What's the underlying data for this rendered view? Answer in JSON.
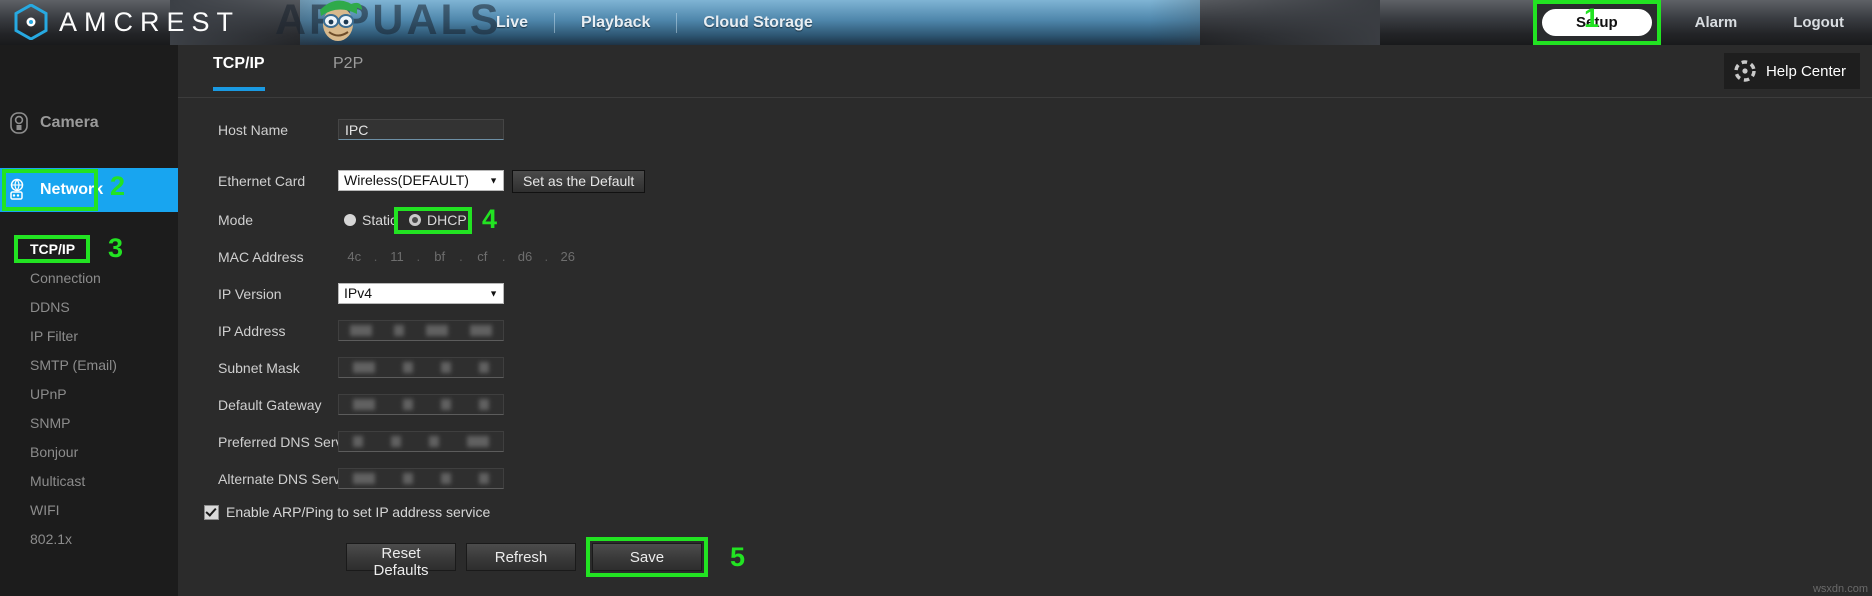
{
  "brand": {
    "name": "AMCREST",
    "logo_icon": "amcrest-hexagon-logo",
    "watermark": "APPUALS"
  },
  "topnav": {
    "main_items": [
      {
        "label": "Live",
        "name": "live"
      },
      {
        "label": "Playback",
        "name": "playback"
      },
      {
        "label": "Cloud Storage",
        "name": "cloud-storage"
      }
    ],
    "right_items": [
      {
        "label": "Setup",
        "name": "setup",
        "highlighted": true
      },
      {
        "label": "Alarm",
        "name": "alarm"
      },
      {
        "label": "Logout",
        "name": "logout"
      }
    ]
  },
  "annotations": {
    "step1": "1",
    "step2": "2",
    "step3": "3",
    "step4": "4",
    "step5": "5",
    "highlight_color": "#22e322"
  },
  "sidebar": {
    "categories": [
      {
        "label": "Camera",
        "icon": "camera-icon",
        "active": false
      },
      {
        "label": "Network",
        "icon": "network-icon",
        "active": true
      }
    ],
    "items": [
      {
        "label": "TCP/IP",
        "selected": true
      },
      {
        "label": "Connection",
        "selected": false
      },
      {
        "label": "DDNS",
        "selected": false
      },
      {
        "label": "IP Filter",
        "selected": false
      },
      {
        "label": "SMTP (Email)",
        "selected": false
      },
      {
        "label": "UPnP",
        "selected": false
      },
      {
        "label": "SNMP",
        "selected": false
      },
      {
        "label": "Bonjour",
        "selected": false
      },
      {
        "label": "Multicast",
        "selected": false
      },
      {
        "label": "WIFI",
        "selected": false
      },
      {
        "label": "802.1x",
        "selected": false
      }
    ]
  },
  "content": {
    "tabs": [
      {
        "label": "TCP/IP",
        "active": true
      },
      {
        "label": "P2P",
        "active": false
      }
    ],
    "help_center": {
      "label": "Help Center",
      "icon": "lifebuoy-icon"
    }
  },
  "form": {
    "host_name": {
      "label": "Host Name",
      "value": "IPC",
      "placeholder": ""
    },
    "ethernet_card": {
      "label": "Ethernet Card",
      "value": "Wireless(DEFAULT)",
      "caret_icon": "chevron-down-icon",
      "set_default_button": "Set as the Default"
    },
    "mode": {
      "label": "Mode",
      "options": [
        {
          "label": "Static",
          "selected": false
        },
        {
          "label": "DHCP",
          "selected": true
        }
      ]
    },
    "mac_address": {
      "label": "MAC Address",
      "octets": [
        "4c",
        "11",
        "bf",
        "cf",
        "d6",
        "26"
      ],
      "separator": "."
    },
    "ip_version": {
      "label": "IP Version",
      "value": "IPv4",
      "caret_icon": "chevron-down-icon"
    },
    "ip_address": {
      "label": "IP Address",
      "value": ""
    },
    "subnet_mask": {
      "label": "Subnet Mask",
      "value": ""
    },
    "default_gateway": {
      "label": "Default Gateway",
      "value": ""
    },
    "preferred_dns": {
      "label": "Preferred DNS Server",
      "value": ""
    },
    "alternate_dns": {
      "label": "Alternate DNS Server",
      "value": ""
    },
    "arp_ping": {
      "label": "Enable ARP/Ping to set IP address service",
      "checked": true
    },
    "buttons": {
      "reset_defaults": "Reset Defaults",
      "refresh": "Refresh",
      "save": "Save"
    }
  },
  "footer": {
    "watermark": "wsxdn.com"
  }
}
